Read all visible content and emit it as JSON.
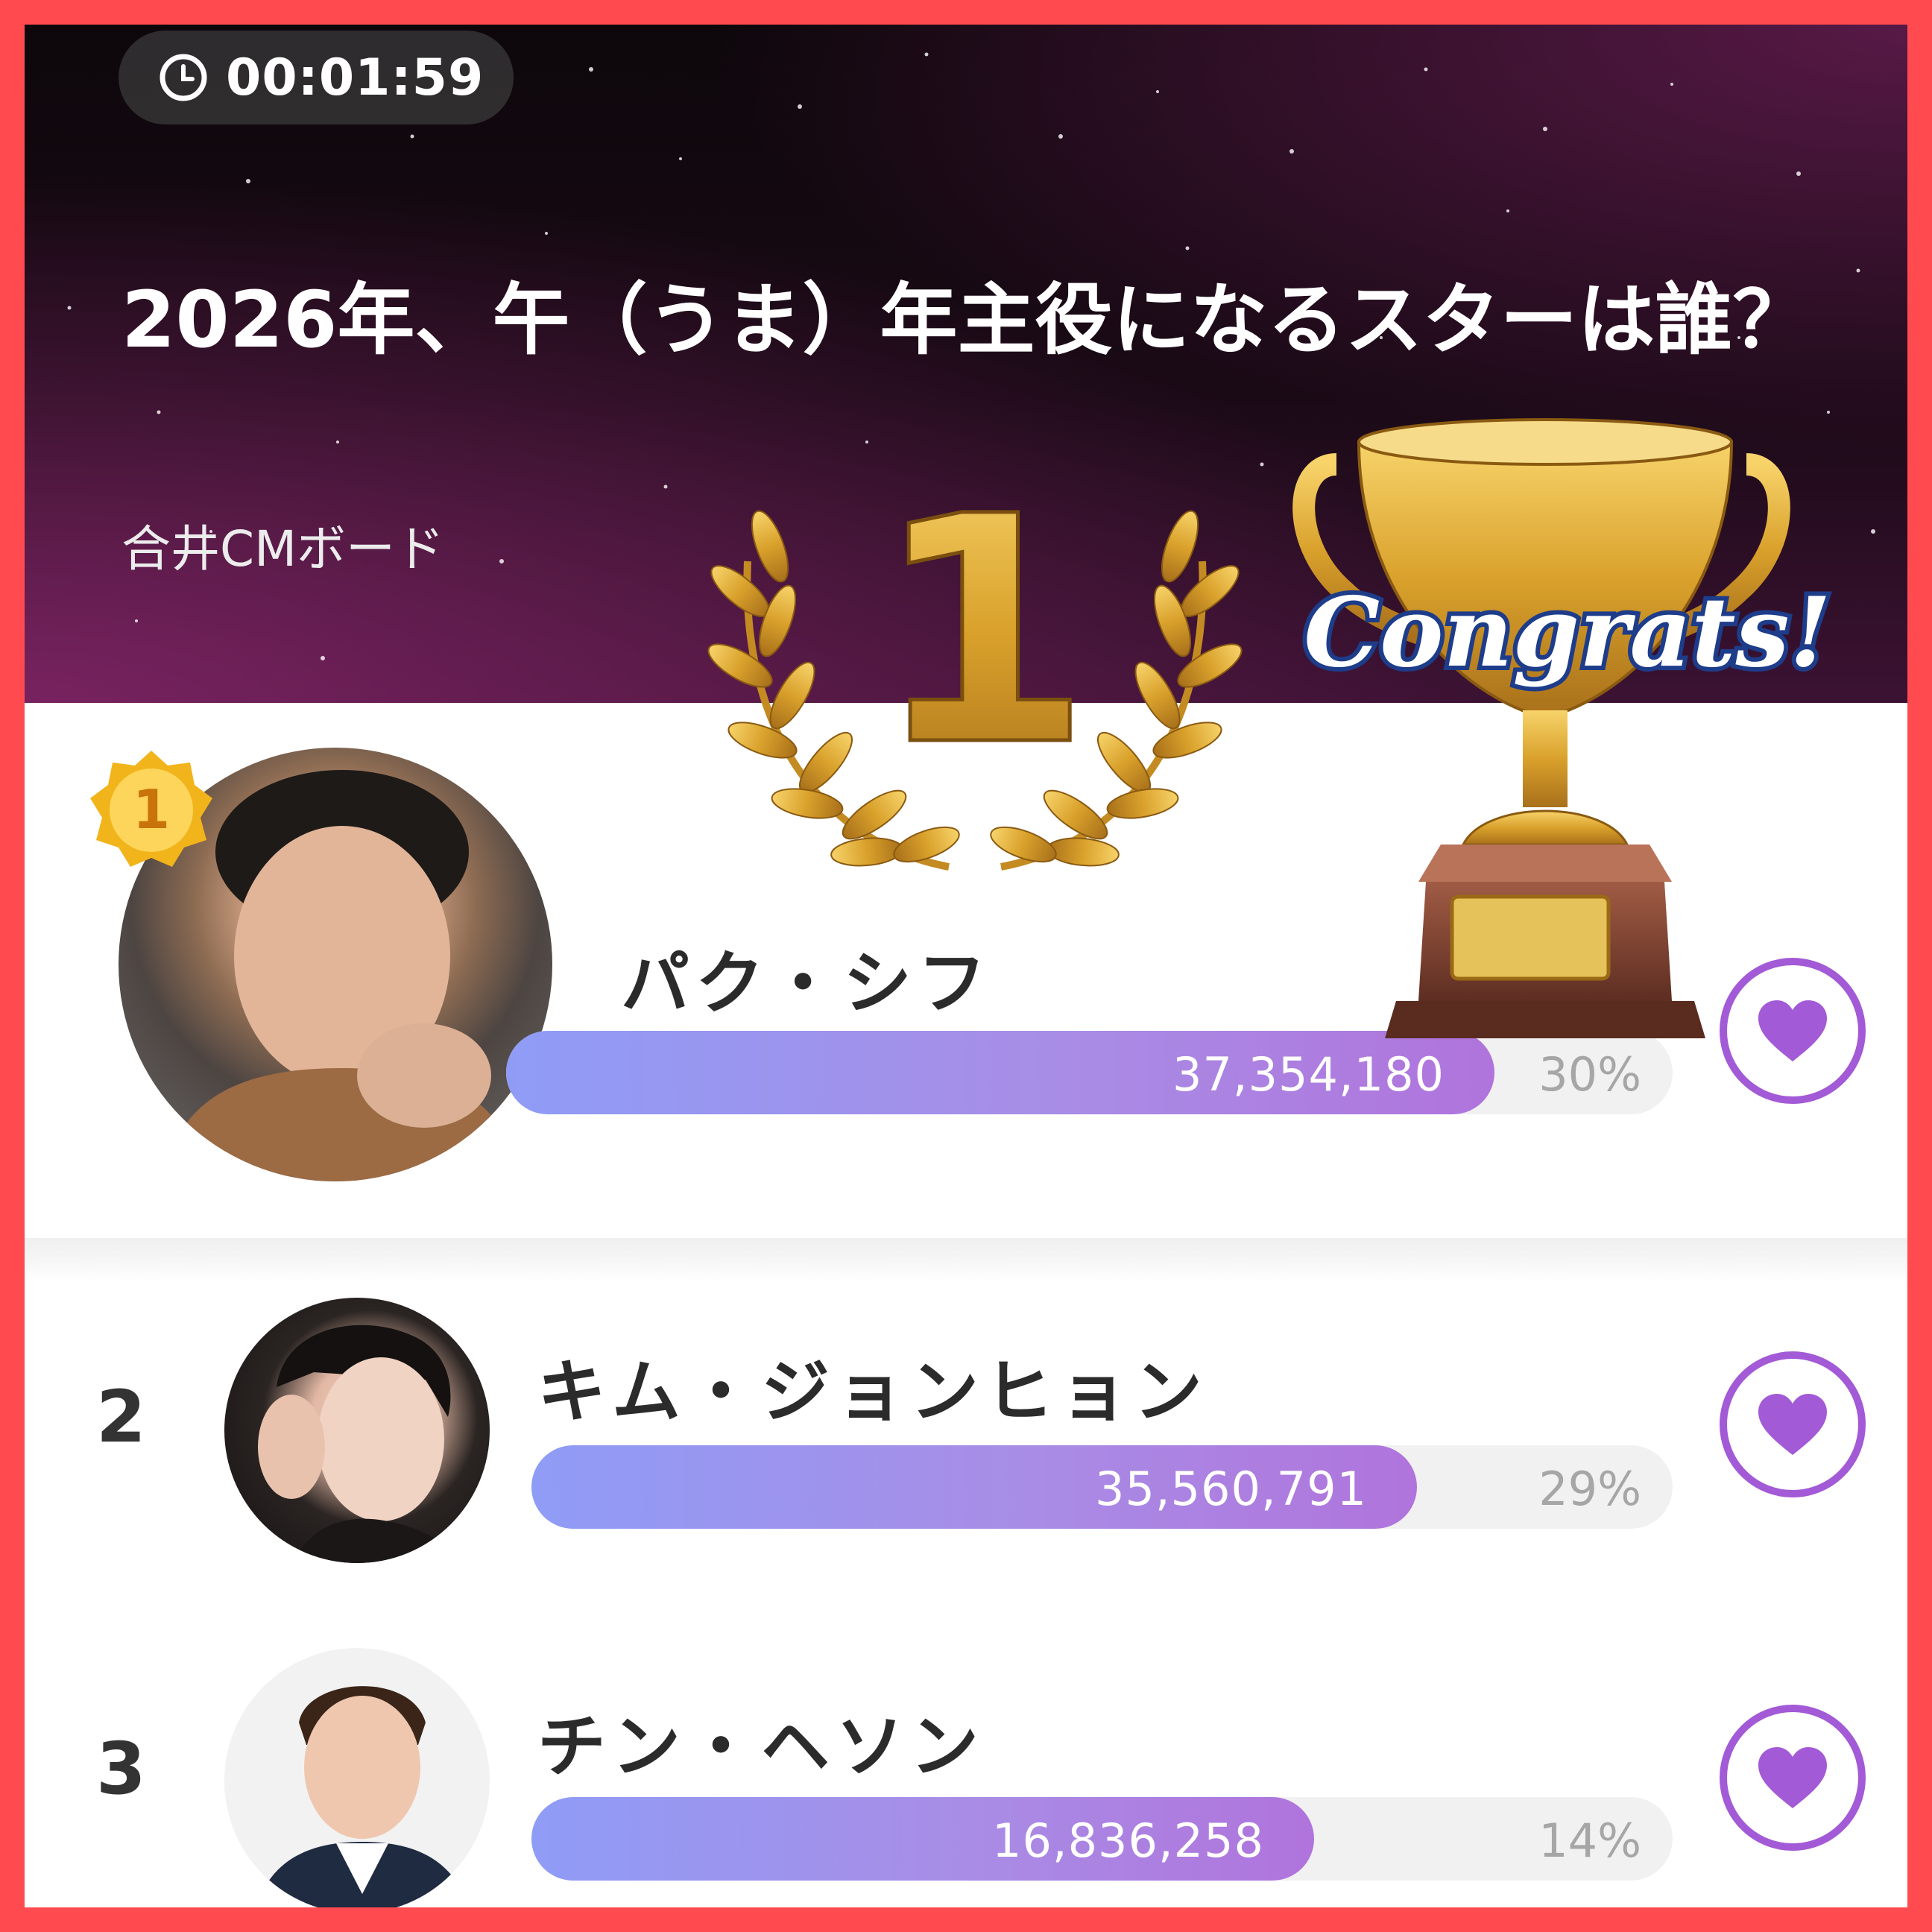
{
  "timer": {
    "text": "00:01:59",
    "icon": "clock-icon"
  },
  "header": {
    "title": "2026年、午（うま）年主役になるスターは誰？",
    "subtitle": "合井CMボード"
  },
  "decoration": {
    "big_rank": "1",
    "congrats": "Congrats!"
  },
  "ranking": [
    {
      "rank": "1",
      "name": "パク・シフ",
      "votes": "37,354,180",
      "percent_label": "30%",
      "fill": 0.847
    },
    {
      "rank": "2",
      "name": "キム・ジョンヒョン",
      "votes": "35,560,791",
      "percent_label": "29%",
      "fill": 0.776
    },
    {
      "rank": "3",
      "name": "チン・ヘソン",
      "votes": "16,836,258",
      "percent_label": "14%",
      "fill": 0.686
    }
  ],
  "colors": {
    "frame": "#ff4b4f",
    "accent": "#a35ad6",
    "bar_start": "#8f9cf6",
    "bar_end": "#b074dc",
    "gold": "#e2a82c"
  }
}
